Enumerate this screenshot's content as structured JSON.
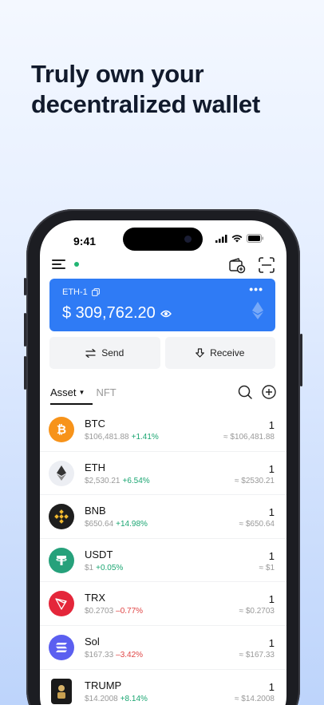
{
  "headline": {
    "line1": "Truly own your",
    "line2": "decentralized wallet"
  },
  "status_bar": {
    "time": "9:41"
  },
  "wallet_card": {
    "network": "ETH-1",
    "more": "•••",
    "balance": "$ 309,762.20"
  },
  "actions": {
    "send": "Send",
    "receive": "Receive"
  },
  "tabs": {
    "asset": "Asset",
    "nft": "NFT"
  },
  "assets": [
    {
      "symbol": "BTC",
      "price": "$106,481.88",
      "change": "+1.41%",
      "direction": "up",
      "qty": "1",
      "value": "≈ $106,481.88",
      "color": "#f7931a",
      "icon": "btc-logo"
    },
    {
      "symbol": "ETH",
      "price": "$2,530.21",
      "change": "+6.54%",
      "direction": "up",
      "qty": "1",
      "value": "≈ $2530.21",
      "color": "#eceef3",
      "icon": "eth-logo"
    },
    {
      "symbol": "BNB",
      "price": "$650.64",
      "change": "+14.98%",
      "direction": "up",
      "qty": "1",
      "value": "≈ $650.64",
      "color": "#1e1e1e",
      "icon": "bnb-logo"
    },
    {
      "symbol": "USDT",
      "price": "$1",
      "change": "+0.05%",
      "direction": "up",
      "qty": "1",
      "value": "≈ $1",
      "color": "#26a17b",
      "icon": "usdt-logo"
    },
    {
      "symbol": "TRX",
      "price": "$0.2703",
      "change": "–0.77%",
      "direction": "down",
      "qty": "1",
      "value": "≈ $0.2703",
      "color": "#e4263a",
      "icon": "trx-logo"
    },
    {
      "symbol": "Sol",
      "price": "$167.33",
      "change": "–3.42%",
      "direction": "down",
      "qty": "1",
      "value": "≈ $167.33",
      "color": "#5b5ff0",
      "icon": "sol-logo"
    },
    {
      "symbol": "TRUMP",
      "price": "$14.2008",
      "change": "+8.14%",
      "direction": "up",
      "qty": "1",
      "value": "≈ $14.2008",
      "color": "#1a1a1a",
      "icon": "trump-logo"
    }
  ]
}
